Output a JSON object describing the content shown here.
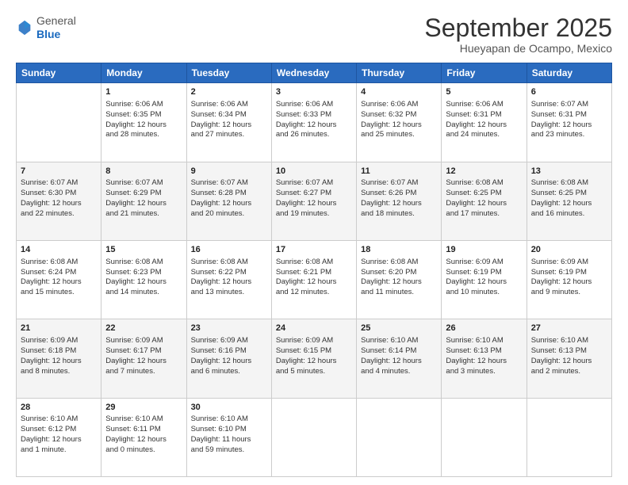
{
  "header": {
    "logo_general": "General",
    "logo_blue": "Blue",
    "month_title": "September 2025",
    "location": "Hueyapan de Ocampo, Mexico"
  },
  "weekdays": [
    "Sunday",
    "Monday",
    "Tuesday",
    "Wednesday",
    "Thursday",
    "Friday",
    "Saturday"
  ],
  "rows": [
    [
      {
        "day": "",
        "info": ""
      },
      {
        "day": "1",
        "info": "Sunrise: 6:06 AM\nSunset: 6:35 PM\nDaylight: 12 hours\nand 28 minutes."
      },
      {
        "day": "2",
        "info": "Sunrise: 6:06 AM\nSunset: 6:34 PM\nDaylight: 12 hours\nand 27 minutes."
      },
      {
        "day": "3",
        "info": "Sunrise: 6:06 AM\nSunset: 6:33 PM\nDaylight: 12 hours\nand 26 minutes."
      },
      {
        "day": "4",
        "info": "Sunrise: 6:06 AM\nSunset: 6:32 PM\nDaylight: 12 hours\nand 25 minutes."
      },
      {
        "day": "5",
        "info": "Sunrise: 6:06 AM\nSunset: 6:31 PM\nDaylight: 12 hours\nand 24 minutes."
      },
      {
        "day": "6",
        "info": "Sunrise: 6:07 AM\nSunset: 6:31 PM\nDaylight: 12 hours\nand 23 minutes."
      }
    ],
    [
      {
        "day": "7",
        "info": "Sunrise: 6:07 AM\nSunset: 6:30 PM\nDaylight: 12 hours\nand 22 minutes."
      },
      {
        "day": "8",
        "info": "Sunrise: 6:07 AM\nSunset: 6:29 PM\nDaylight: 12 hours\nand 21 minutes."
      },
      {
        "day": "9",
        "info": "Sunrise: 6:07 AM\nSunset: 6:28 PM\nDaylight: 12 hours\nand 20 minutes."
      },
      {
        "day": "10",
        "info": "Sunrise: 6:07 AM\nSunset: 6:27 PM\nDaylight: 12 hours\nand 19 minutes."
      },
      {
        "day": "11",
        "info": "Sunrise: 6:07 AM\nSunset: 6:26 PM\nDaylight: 12 hours\nand 18 minutes."
      },
      {
        "day": "12",
        "info": "Sunrise: 6:08 AM\nSunset: 6:25 PM\nDaylight: 12 hours\nand 17 minutes."
      },
      {
        "day": "13",
        "info": "Sunrise: 6:08 AM\nSunset: 6:25 PM\nDaylight: 12 hours\nand 16 minutes."
      }
    ],
    [
      {
        "day": "14",
        "info": "Sunrise: 6:08 AM\nSunset: 6:24 PM\nDaylight: 12 hours\nand 15 minutes."
      },
      {
        "day": "15",
        "info": "Sunrise: 6:08 AM\nSunset: 6:23 PM\nDaylight: 12 hours\nand 14 minutes."
      },
      {
        "day": "16",
        "info": "Sunrise: 6:08 AM\nSunset: 6:22 PM\nDaylight: 12 hours\nand 13 minutes."
      },
      {
        "day": "17",
        "info": "Sunrise: 6:08 AM\nSunset: 6:21 PM\nDaylight: 12 hours\nand 12 minutes."
      },
      {
        "day": "18",
        "info": "Sunrise: 6:08 AM\nSunset: 6:20 PM\nDaylight: 12 hours\nand 11 minutes."
      },
      {
        "day": "19",
        "info": "Sunrise: 6:09 AM\nSunset: 6:19 PM\nDaylight: 12 hours\nand 10 minutes."
      },
      {
        "day": "20",
        "info": "Sunrise: 6:09 AM\nSunset: 6:19 PM\nDaylight: 12 hours\nand 9 minutes."
      }
    ],
    [
      {
        "day": "21",
        "info": "Sunrise: 6:09 AM\nSunset: 6:18 PM\nDaylight: 12 hours\nand 8 minutes."
      },
      {
        "day": "22",
        "info": "Sunrise: 6:09 AM\nSunset: 6:17 PM\nDaylight: 12 hours\nand 7 minutes."
      },
      {
        "day": "23",
        "info": "Sunrise: 6:09 AM\nSunset: 6:16 PM\nDaylight: 12 hours\nand 6 minutes."
      },
      {
        "day": "24",
        "info": "Sunrise: 6:09 AM\nSunset: 6:15 PM\nDaylight: 12 hours\nand 5 minutes."
      },
      {
        "day": "25",
        "info": "Sunrise: 6:10 AM\nSunset: 6:14 PM\nDaylight: 12 hours\nand 4 minutes."
      },
      {
        "day": "26",
        "info": "Sunrise: 6:10 AM\nSunset: 6:13 PM\nDaylight: 12 hours\nand 3 minutes."
      },
      {
        "day": "27",
        "info": "Sunrise: 6:10 AM\nSunset: 6:13 PM\nDaylight: 12 hours\nand 2 minutes."
      }
    ],
    [
      {
        "day": "28",
        "info": "Sunrise: 6:10 AM\nSunset: 6:12 PM\nDaylight: 12 hours\nand 1 minute."
      },
      {
        "day": "29",
        "info": "Sunrise: 6:10 AM\nSunset: 6:11 PM\nDaylight: 12 hours\nand 0 minutes."
      },
      {
        "day": "30",
        "info": "Sunrise: 6:10 AM\nSunset: 6:10 PM\nDaylight: 11 hours\nand 59 minutes."
      },
      {
        "day": "",
        "info": ""
      },
      {
        "day": "",
        "info": ""
      },
      {
        "day": "",
        "info": ""
      },
      {
        "day": "",
        "info": ""
      }
    ]
  ]
}
